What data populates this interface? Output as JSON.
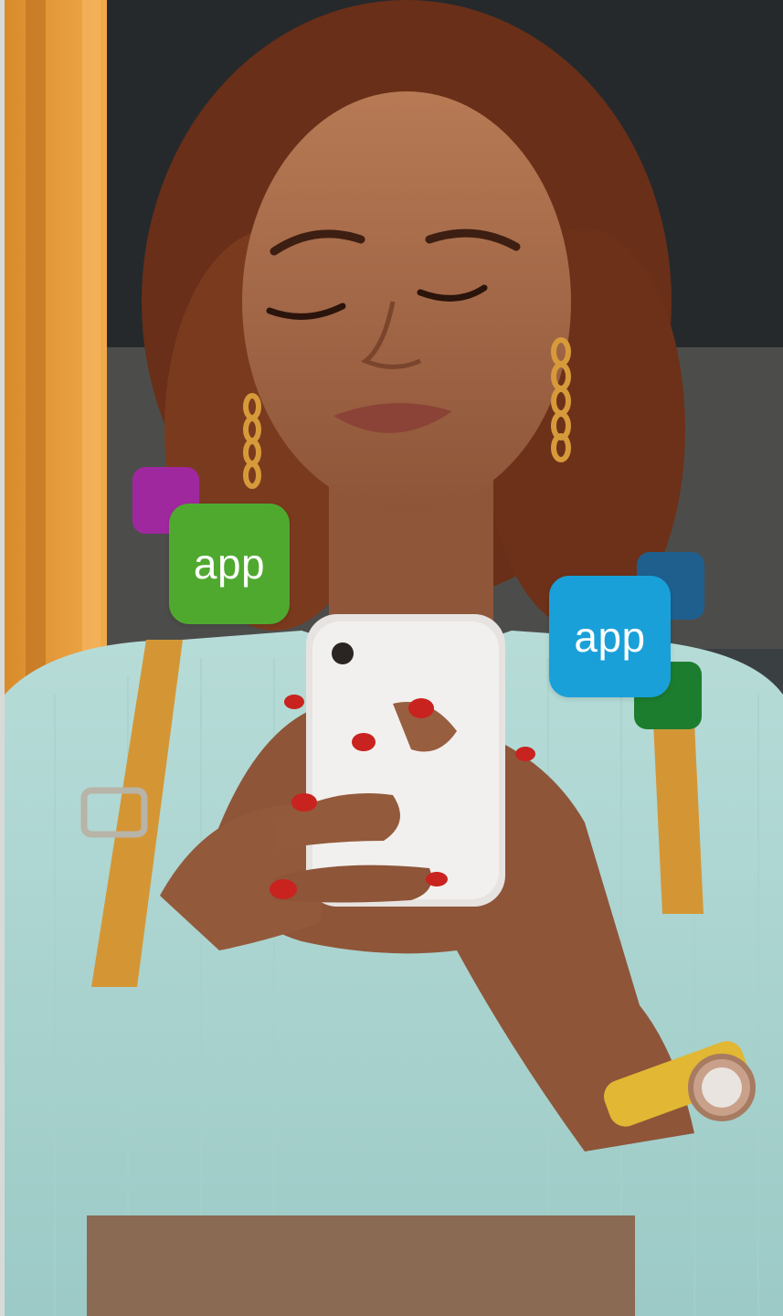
{
  "badges": {
    "left": {
      "label": "app",
      "color": "#4fa92f"
    },
    "right": {
      "label": "app",
      "color": "#1aa0d8"
    }
  },
  "decor_colors": {
    "purple": "#a0289e",
    "navy": "#1f5f8e",
    "dark_green": "#1d7d2e"
  },
  "photo_subject": "woman-smiling-at-smartphone"
}
